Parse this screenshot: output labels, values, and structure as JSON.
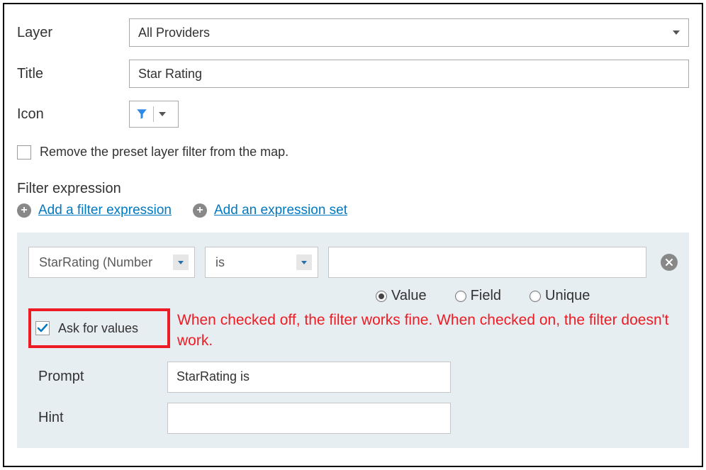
{
  "form": {
    "layer_label": "Layer",
    "layer_value": "All Providers",
    "title_label": "Title",
    "title_value": "Star Rating",
    "icon_label": "Icon",
    "remove_preset_label": "Remove the preset layer filter from the map.",
    "remove_preset_checked": false
  },
  "filter": {
    "section_title": "Filter expression",
    "add_expr": "Add a filter expression",
    "add_set": "Add an expression set"
  },
  "expr": {
    "field": "StarRating (Number",
    "operator": "is",
    "value": "",
    "value_type": "Value",
    "radios": {
      "value": "Value",
      "field": "Field",
      "unique": "Unique"
    },
    "ask_label": "Ask for values",
    "ask_checked": true,
    "prompt_label": "Prompt",
    "prompt_value": "StarRating is",
    "hint_label": "Hint",
    "hint_value": ""
  },
  "annotation": {
    "text": "When checked off, the filter works fine.  When checked on, the filter doesn't work."
  }
}
